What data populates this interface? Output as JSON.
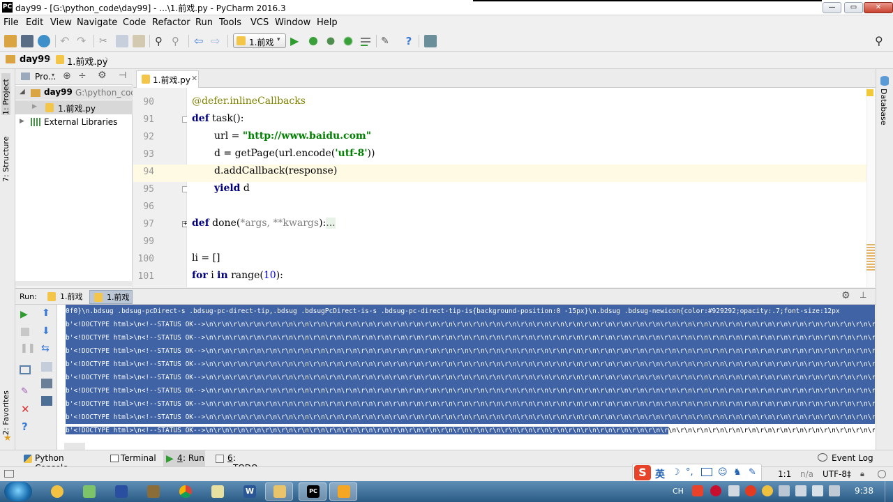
{
  "window": {
    "title": "day99 - [G:\\python_code\\day99] - ...\\1.前戏.py - PyCharm 2016.3",
    "app_icon": "PC",
    "minimize": "—",
    "maximize": "▭",
    "close": "✕"
  },
  "menu": [
    "File",
    "Edit",
    "View",
    "Navigate",
    "Code",
    "Refactor",
    "Run",
    "Tools",
    "VCS",
    "Window",
    "Help"
  ],
  "toolbar": {
    "run_config": "1.前戏"
  },
  "breadcrumb": {
    "project": "day99",
    "file": "1.前戏.py"
  },
  "left_strip": {
    "project_tab": "1: Project",
    "structure_tab": "7: Structure",
    "favorites_tab": "2: Favorites"
  },
  "project_panel": {
    "header": "Pro...",
    "tree": [
      {
        "name": "day99",
        "path": "G:\\python_code"
      },
      {
        "name": "1.前戏.py"
      },
      {
        "name": "External Libraries"
      }
    ]
  },
  "editor": {
    "tab": "1.前戏.py",
    "lines": [
      {
        "n": "90"
      },
      {
        "n": "91"
      },
      {
        "n": "92"
      },
      {
        "n": "93"
      },
      {
        "n": "94"
      },
      {
        "n": "95"
      },
      {
        "n": "96"
      },
      {
        "n": "97"
      },
      {
        "n": "99"
      },
      {
        "n": "100"
      },
      {
        "n": "101"
      }
    ],
    "code": {
      "l90": "@defer.inlineCallbacks",
      "l91_kw": "def",
      "l91_rest": " task():",
      "l92_a": "url = ",
      "l92_str": "\"http://www.baidu.com\"",
      "l93_a": "d = getPage(url.encode(",
      "l93_str": "'utf-8'",
      "l93_b": "))",
      "l94": "d.addCallback(response)",
      "l95_kw": "yield",
      "l95_rest": " d",
      "l97_kw": "def",
      "l97_a": " done(",
      "l97_param": "*args, **kwargs",
      "l97_b": "):",
      "l97_fold": "...",
      "l100": "li = []",
      "l101_kw1": "for",
      "l101_a": " i ",
      "l101_kw2": "in",
      "l101_b": " range(",
      "l101_num": "10",
      "l101_c": "):"
    }
  },
  "right_strip": {
    "database_tab": "Database"
  },
  "run_panel": {
    "label": "Run:",
    "tabs": [
      "1.前戏",
      "1.前戏"
    ],
    "console": {
      "first_line": "0f0}\\n.bdsug .bdsug-pcDirect-s .bdsug-pc-direct-tip,.bdsug .bdsugPcDirect-is-s .bdsug-pc-direct-tip-is{background-position:0 -15px}\\n.bdsug .bdsug-newicon{color:#929292;opacity:.7;font-size:12px",
      "line_prefix": "b'<!DOCTYPE html>\\n<!--STATUS OK-->",
      "line_tail": "\\n\\r\\n\\r\\n\\r\\n\\r\\n\\r\\n\\r\\n\\r\\n\\r\\n\\r\\n\\r\\n\\r\\n\\r\\n\\r\\n\\r\\n\\r\\n\\r\\n\\r\\n\\r\\n\\r\\n\\r\\n\\r\\n\\r\\n\\r\\n\\r\\n\\r\\n\\r\\n\\r\\n\\r\\n\\r\\n\\r\\n\\r\\n\\r\\n\\r\\n\\r\\n\\r\\n\\r\\n\\r\\n\\r\\n\\r\\n\\r\\n\\r\\n\\r\\n\\r\\n\\r\\n\\r\\n\\r\\n\\r\\n",
      "last_selected": "b'<!DOCTYPE html>\\n<!--STATUS OK-->\\n\\r\\n\\r\\n\\r\\n\\r\\n\\r\\n\\r\\n\\r\\n\\r\\n\\r\\n\\r\\n\\r\\n\\r\\n\\r\\n\\r\\n\\r\\n\\r\\n\\r\\n\\r\\n\\r\\n\\r\\n\\r\\n\\r\\n\\r\\n\\r\\n\\r\\n\\r\\n\\r\\n\\r\\n\\r",
      "last_unselected": "\\n\\r\\n\\r\\n\\r\\n\\r\\n\\r\\n\\r\\n\\r\\n\\r\\n\\r\\n\\r\\n\\r\\n\\r\\n\\r\\n\\r\\n\\r\\n\\r\\n\\r\\n\\r\\n\\r\\n\\r\\n\\r\\n\\r\\n\\r\\n\\r\\n\\r\\n\\r\\n\\r\\n\\r\\n\\r\\n\\r\\n"
    }
  },
  "bottom_tabs": {
    "python_console": "Python Console",
    "terminal": "Terminal",
    "run_num": "4",
    "run": ": Run",
    "todo_num": "6",
    "todo": ": TODO",
    "event_log": "Event Log"
  },
  "status": {
    "position": "1:1",
    "na": "n/a",
    "encoding": "UTF-8‡",
    "ime": "英"
  },
  "taskbar": {
    "lang": "CH",
    "clock": "9:38"
  },
  "colors": {
    "selection": "#3f63a5",
    "keyword": "#000080",
    "string": "#008000",
    "decorator": "#808000",
    "number": "#0000ff",
    "highlight_line": "#fffae3"
  }
}
